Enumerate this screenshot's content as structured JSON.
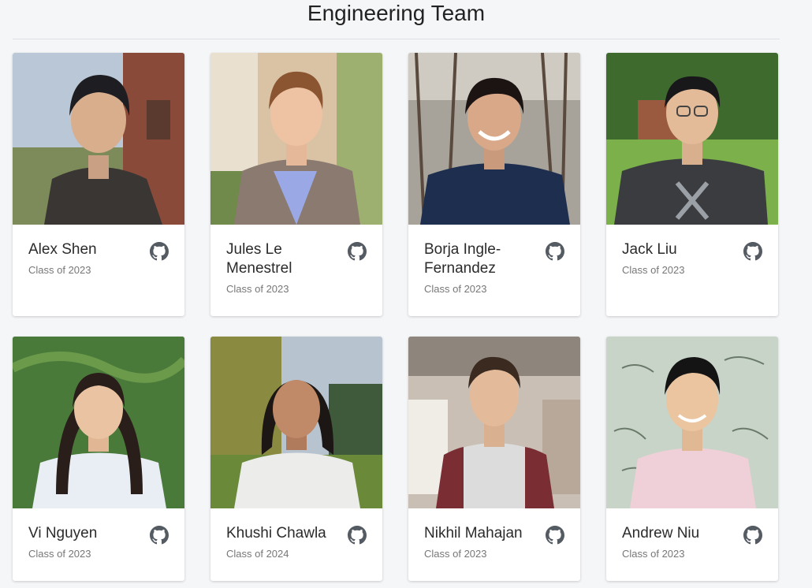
{
  "page": {
    "title": "Engineering Team"
  },
  "members": [
    {
      "name": "Alex Shen",
      "meta": "Class of 2023",
      "github_icon": "github-icon"
    },
    {
      "name": "Jules Le Menestrel",
      "meta": "Class of 2023",
      "github_icon": "github-icon"
    },
    {
      "name": "Borja Ingle-Fernandez",
      "meta": "Class of 2023",
      "github_icon": "github-icon"
    },
    {
      "name": "Jack Liu",
      "meta": "Class of 2023",
      "github_icon": "github-icon"
    },
    {
      "name": "Vi Nguyen",
      "meta": "Class of 2023",
      "github_icon": "github-icon"
    },
    {
      "name": "Khushi Chawla",
      "meta": "Class of 2024",
      "github_icon": "github-icon"
    },
    {
      "name": "Nikhil Mahajan",
      "meta": "Class of 2023",
      "github_icon": "github-icon"
    },
    {
      "name": "Andrew Niu",
      "meta": "Class of 2023",
      "github_icon": "github-icon"
    }
  ],
  "colors": {
    "background": "#f5f6f8",
    "card": "#ffffff",
    "icon": "#555b63"
  }
}
